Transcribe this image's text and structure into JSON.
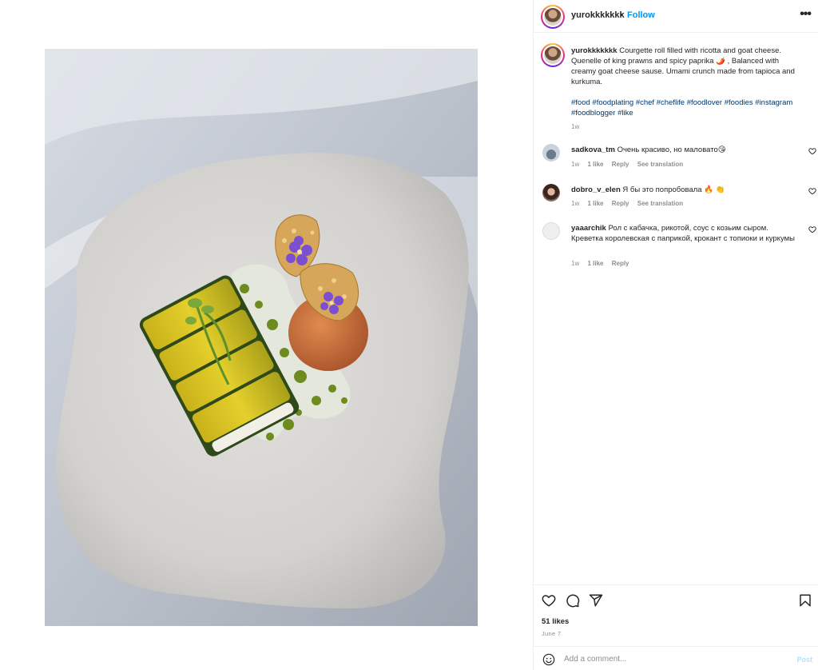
{
  "post": {
    "username": "yurokkkkkkk",
    "dot": "•",
    "follow_label": "Follow",
    "more_label": "•••"
  },
  "caption": {
    "username": "yurokkkkkkk",
    "text": "Courgette roll filled with ricotta and goat cheese. Quenelle of king prawns and spicy paprika 🌶️ , Balanced with creamy goat cheese sause. Umami crunch made from tapioca and kurkuma.",
    "hashtags": "#food #foodplating #chef #cheflife #foodlover #foodies #instagram #foodblogger #like",
    "time": "1w"
  },
  "comments": [
    {
      "username": "sadkova_tm",
      "text": "Очень красиво, но маловато😘",
      "time": "1w",
      "likes": "1 like",
      "reply": "Reply",
      "translate": "See translation"
    },
    {
      "username": "dobro_v_elen",
      "text": "Я бы это попробовала 🔥 👏",
      "time": "1w",
      "likes": "1 like",
      "reply": "Reply",
      "translate": "See translation"
    },
    {
      "username": "yaaarchik",
      "text": "Рол с кабачка, рикотой, соус с козьим сыром. Креветка королевская с паприкой, крокант с топиоки и куркумы",
      "time": "1w",
      "likes": "1 like",
      "reply": "Reply"
    }
  ],
  "actions": {
    "likes": "51 likes",
    "date": "June 7"
  },
  "add_comment": {
    "placeholder": "Add a comment...",
    "post_label": "Post"
  },
  "icons": [
    "heart-icon",
    "comment-icon",
    "share-icon",
    "bookmark-icon",
    "emoji-icon",
    "more-icon"
  ],
  "colors": {
    "follow": "#0095f6",
    "hashtag": "#00376b",
    "muted": "#8e8e8e",
    "post_disabled": "#b2dffc"
  }
}
